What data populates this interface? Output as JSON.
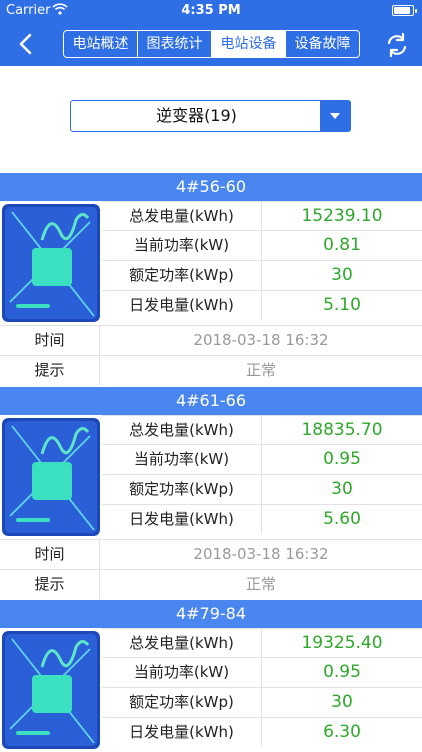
{
  "status_bar": {
    "carrier": "Carrier",
    "time": "4:35 PM",
    "battery_level": 0.9
  },
  "nav": {
    "back_icon": "chevron-left-icon",
    "refresh_icon": "refresh-icon",
    "tabs": [
      {
        "label": "电站概述",
        "active": false
      },
      {
        "label": "图表统计",
        "active": false
      },
      {
        "label": "电站设备",
        "active": true
      },
      {
        "label": "设备故障",
        "active": false
      }
    ]
  },
  "selector": {
    "label": "逆变器(19)",
    "icon": "dropdown-arrow-icon"
  },
  "colors": {
    "primary": "#2f6fe6",
    "header": "#4a86f0",
    "value_green": "#2ea82a",
    "muted": "#9a9a9a"
  },
  "labels": {
    "total_energy": "总发电量(kWh)",
    "current_power": "当前功率(kW)",
    "rated_power": "额定功率(kWp)",
    "daily_energy": "日发电量(kWh)",
    "time": "时间",
    "hint": "提示"
  },
  "devices": [
    {
      "name": "4#56-60",
      "total_energy": "15239.10",
      "current_power": "0.81",
      "rated_power": "30",
      "daily_energy": "5.10",
      "time": "2018-03-18 16:32",
      "hint": "正常"
    },
    {
      "name": "4#61-66",
      "total_energy": "18835.70",
      "current_power": "0.95",
      "rated_power": "30",
      "daily_energy": "5.60",
      "time": "2018-03-18 16:32",
      "hint": "正常"
    },
    {
      "name": "4#79-84",
      "total_energy": "19325.40",
      "current_power": "0.95",
      "rated_power": "30",
      "daily_energy": "6.30"
    }
  ]
}
